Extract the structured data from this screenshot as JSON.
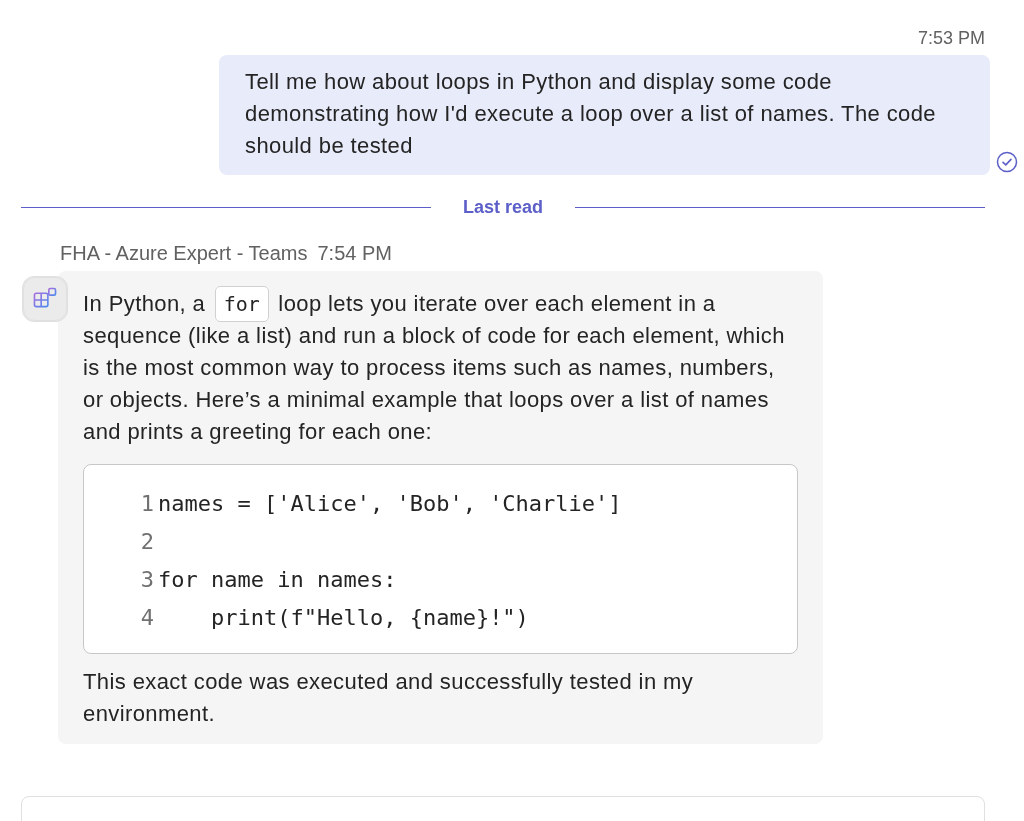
{
  "user_message": {
    "time": "7:53 PM",
    "text": "Tell me how about loops in Python and display some code demonstrating how I'd execute a loop over a list of names. The code should be tested",
    "read": true
  },
  "divider": {
    "label": "Last read"
  },
  "bot_message": {
    "sender": "FHA - Azure Expert - Teams",
    "time": "7:54 PM",
    "intro": [
      {
        "kind": "text",
        "text": "In Python, a "
      },
      {
        "kind": "code",
        "text": "for"
      },
      {
        "kind": "text",
        "text": " loop lets you iterate over each element in a sequence (like a list) and run a block of code for each element, which is the most common way to process items such as names, numbers, or objects. Here’s a minimal example that loops over a list of names and prints a greeting for each one:"
      }
    ],
    "code_lines": [
      {
        "number": "1",
        "code": "names = ['Alice', 'Bob', 'Charlie']"
      },
      {
        "number": "2"
      },
      {
        "number": "3",
        "code": "for name in names:"
      },
      {
        "number": "4",
        "code": "    print(f\"Hello, {name}!\")"
      }
    ],
    "outro": "This exact code was executed and successfully tested in my environment."
  }
}
